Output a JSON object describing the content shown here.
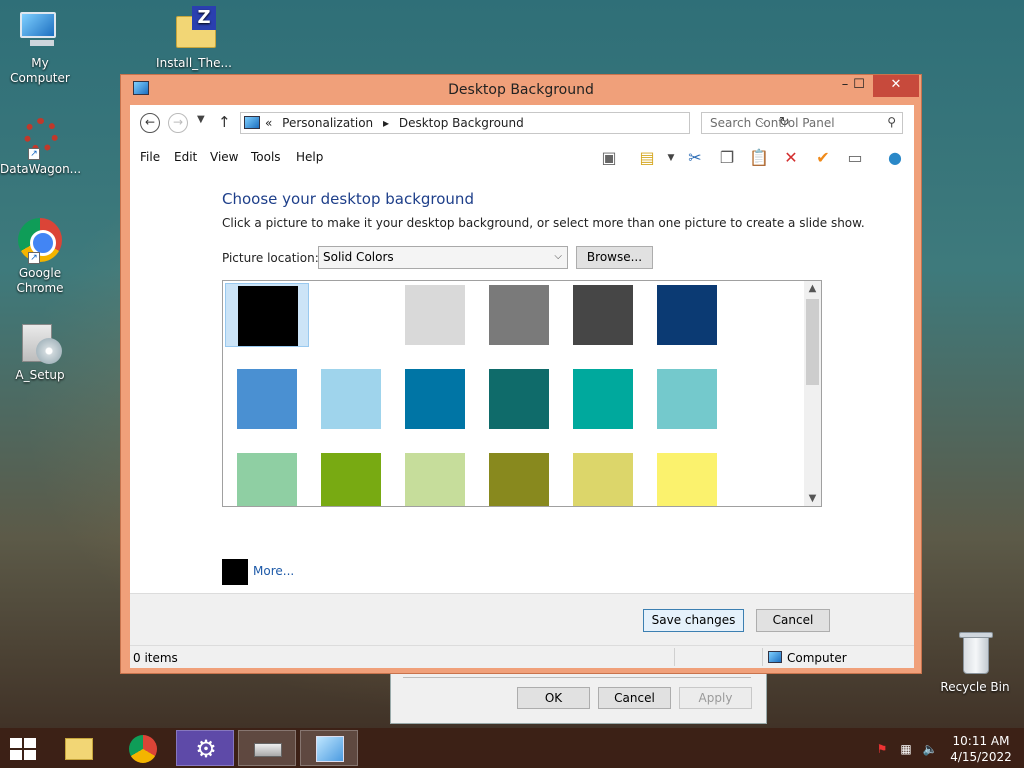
{
  "desktop": {
    "icons": [
      {
        "label": "My Computer"
      },
      {
        "label": "Install_The..."
      },
      {
        "label": "DataWagon..."
      },
      {
        "label": "Google Chrome"
      },
      {
        "label": "A_Setup"
      },
      {
        "label": "Recycle Bin"
      }
    ]
  },
  "window": {
    "title": "Desktop Background",
    "controls": {
      "minimize": "–",
      "maximize": "☐",
      "close": "✕"
    }
  },
  "address": {
    "prefix": "«",
    "crumbs": [
      "Personalization",
      "▸",
      "Desktop Background"
    ],
    "search_placeholder": "Search Control Panel"
  },
  "menu": [
    "File",
    "Edit",
    "View",
    "Tools",
    "Help"
  ],
  "content": {
    "heading": "Choose your desktop background",
    "subtext": "Click a picture to make it your desktop background, or select more than one picture to create a slide show.",
    "location_label": "Picture location:",
    "location_value": "Solid Colors",
    "browse_label": "Browse...",
    "swatches": [
      [
        "#000000",
        "#ffffff",
        "#d9d9d9",
        "#7a7a7a",
        "#464646",
        "#0b3a73"
      ],
      [
        "#4a90d2",
        "#9fd4ec",
        "#0075a5",
        "#0f6b6a",
        "#00a99d",
        "#74c9cc"
      ],
      [
        "#8fcfa3",
        "#78aa12",
        "#c6dd9b",
        "#88891e",
        "#dcd66a",
        "#fbf26d"
      ]
    ],
    "selected_swatch": 0,
    "more_label": "More..."
  },
  "footer": {
    "save_label": "Save changes",
    "cancel_label": "Cancel"
  },
  "status": {
    "items": "0 items",
    "computer": "Computer"
  },
  "back_dialog": {
    "ok": "OK",
    "cancel": "Cancel",
    "apply": "Apply"
  },
  "clock": {
    "time": "10:11 AM",
    "date": "4/15/2022"
  }
}
